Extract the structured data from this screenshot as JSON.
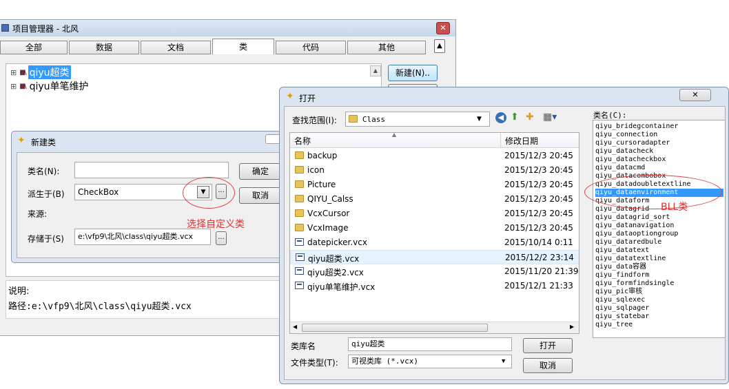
{
  "pm": {
    "title": "项目管理器 - 北风",
    "tabs": [
      "全部",
      "数据",
      "文档",
      "类",
      "代码",
      "其他"
    ],
    "tree": [
      "qiyu超类",
      "qiyu单笔维护"
    ],
    "new_btn": "新建(N)..",
    "desc_label": "说明:",
    "path_label": "路径:e:\\vfp9\\北风\\class\\qiyu超类.vcx"
  },
  "newclass": {
    "title": "新建类",
    "name_label": "类名(N):",
    "name_value": "",
    "based_label": "派生于(B)",
    "based_value": "CheckBox",
    "source_label": "来源:",
    "store_label": "存储于(S)",
    "store_value": "e:\\vfp9\\北风\\class\\qiyu超类.vcx",
    "ok": "确定",
    "cancel": "取消",
    "ellipsis": "..."
  },
  "annotations": {
    "choose_custom": "选择自定义类",
    "bll": "BLL类"
  },
  "open": {
    "title": "打开",
    "lookin_label": "查找范围(I):",
    "lookin_value": "Class",
    "col_name": "名称",
    "col_date": "修改日期",
    "files": [
      {
        "name": "backup",
        "date": "2015/12/3 20:45",
        "type": "folder"
      },
      {
        "name": "icon",
        "date": "2015/12/3 20:45",
        "type": "folder"
      },
      {
        "name": "Picture",
        "date": "2015/12/3 20:45",
        "type": "folder"
      },
      {
        "name": "QIYU_Calss",
        "date": "2015/12/3 20:45",
        "type": "folder"
      },
      {
        "name": "VcxCursor",
        "date": "2015/12/3 20:45",
        "type": "folder"
      },
      {
        "name": "VcxImage",
        "date": "2015/12/3 20:45",
        "type": "folder"
      },
      {
        "name": "datepicker.vcx",
        "date": "2015/10/14 0:11",
        "type": "file"
      },
      {
        "name": "qiyu超类.vcx",
        "date": "2015/12/2 23:14",
        "type": "file"
      },
      {
        "name": "qiyu超类2.vcx",
        "date": "2015/11/20 21:39",
        "type": "file"
      },
      {
        "name": "qiyu单笔维护.vcx",
        "date": "2015/12/1 21:33",
        "type": "file"
      }
    ],
    "selected_index": 7,
    "libname_label": "类库名",
    "libname_value": "qiyu超类",
    "filetype_label": "文件类型(T):",
    "filetype_value": "可视类库 (*.vcx)",
    "open_btn": "打开",
    "cancel_btn": "取消",
    "classes_label": "类名(C):",
    "classes": [
      "qiyu_bridegcontainer",
      "qiyu_connection",
      "qiyu_cursoradapter",
      "qiyu_datacheck",
      "qiyu_datacheckbox",
      "qiyu_datacmd",
      "qiyu_datacombobox",
      "qiyu_datadoubletextline",
      "qiyu_dataenvironment",
      "qiyu_dataform",
      "qiyu_datagrid",
      "qiyu_datagrid_sort",
      "qiyu_datanavigation",
      "qiyu_dataoptiongroup",
      "qiyu_dataredbule",
      "qiyu_datatext",
      "qiyu_datatextline",
      "qiyu_data容器",
      "qiyu_findform",
      "qiyu_formfindsingle",
      "qiyu_pic审核",
      "qiyu_sqlexec",
      "qiyu_sqlpager",
      "qiyu_statebar",
      "qiyu_tree"
    ],
    "selected_class_index": 8
  }
}
